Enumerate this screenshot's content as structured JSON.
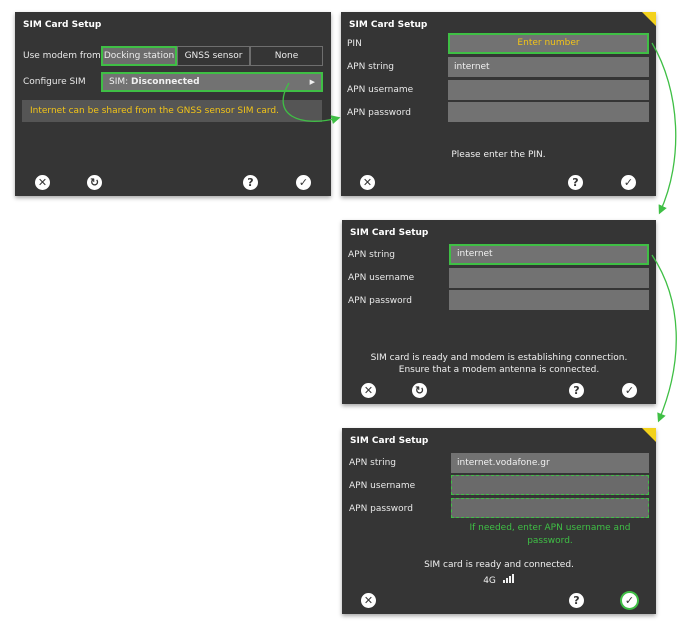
{
  "panel1": {
    "title": "SIM Card Setup",
    "use_modem_label": "Use modem from",
    "modem_options": [
      "Docking station",
      "GNSS sensor",
      "None"
    ],
    "configure_sim_label": "Configure SIM",
    "sim_prefix": "SIM:",
    "sim_status": "Disconnected",
    "info_text": "Internet can be shared from the GNSS sensor SIM card.",
    "footer": {
      "close": "✕",
      "reset": "↻",
      "help": "?",
      "ok": "✓"
    }
  },
  "panel2": {
    "title": "SIM Card Setup",
    "pin_label": "PIN",
    "pin_placeholder": "Enter number",
    "apn_string_label": "APN string",
    "apn_string_value": "internet",
    "apn_username_label": "APN username",
    "apn_password_label": "APN password",
    "message": "Please enter the PIN.",
    "footer": {
      "close": "✕",
      "help": "?",
      "ok": "✓"
    }
  },
  "panel3": {
    "title": "SIM Card Setup",
    "apn_string_label": "APN string",
    "apn_string_value": "internet",
    "apn_username_label": "APN username",
    "apn_password_label": "APN password",
    "message_line1": "SIM card is ready and modem is establishing connection.",
    "message_line2": "Ensure that a modem antenna is connected.",
    "footer": {
      "close": "✕",
      "reset": "↻",
      "help": "?",
      "ok": "✓"
    }
  },
  "panel4": {
    "title": "SIM Card Setup",
    "apn_string_label": "APN string",
    "apn_string_value": "internet.vodafone.gr",
    "apn_username_label": "APN username",
    "apn_password_label": "APN password",
    "hint_line1": "If needed, enter APN username and",
    "hint_line2": "password.",
    "status": "SIM card is ready and connected.",
    "network": "4G",
    "footer": {
      "close": "✕",
      "help": "?",
      "ok": "✓"
    }
  },
  "colors": {
    "panel_bg": "#353535",
    "field_bg": "#727272",
    "highlight": "#3fbf45",
    "warning": "#f2c418",
    "corner": "#f3d21c"
  }
}
